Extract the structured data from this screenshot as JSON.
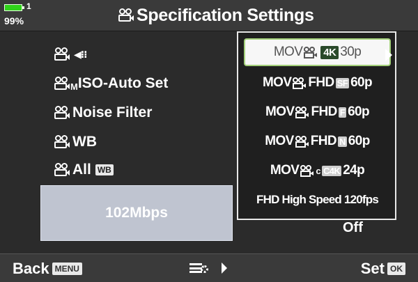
{
  "status": {
    "battery_level": "1",
    "battery_percent": "99%"
  },
  "header": {
    "title": "Specification Settings"
  },
  "menu": {
    "items": [
      {
        "name": "codec",
        "label": ""
      },
      {
        "name": "iso-auto-set",
        "label": "ISO-Auto Set",
        "sub": "M"
      },
      {
        "name": "noise-filter",
        "label": "Noise Filter"
      },
      {
        "name": "wb",
        "label": "WB"
      },
      {
        "name": "all-wb",
        "label": "All",
        "badge": "WB"
      }
    ],
    "bitrate": "102Mbps"
  },
  "popup": {
    "options": [
      {
        "pre": "MOV",
        "chip": "4K",
        "post": "30p",
        "selected": true
      },
      {
        "pre": "MOV",
        "text": "FHD",
        "chip": "SF",
        "post": "60p"
      },
      {
        "pre": "MOV",
        "text": "FHD",
        "chip": "F",
        "post": "60p"
      },
      {
        "pre": "MOV",
        "text": "FHD",
        "chip": "N",
        "post": "60p"
      },
      {
        "pre": "MOV",
        "sub": "c",
        "chip": "C4K",
        "post": "24p"
      },
      {
        "text": "FHD High Speed 120fps"
      }
    ],
    "below_value": "Off"
  },
  "footer": {
    "back_label": "Back",
    "back_badge": "MENU",
    "set_label": "Set",
    "set_badge": "OK"
  },
  "colors": {
    "accent_green": "#2fd31a",
    "selection_border": "#a3d07a"
  }
}
